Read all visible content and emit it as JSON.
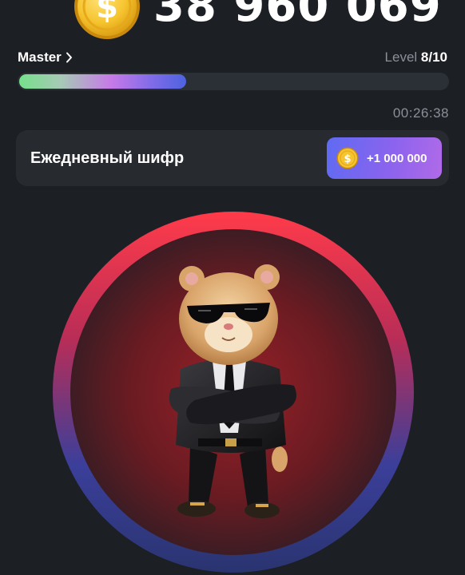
{
  "balance": {
    "value": "38 960 069",
    "coin_icon": "dollar-coin-icon"
  },
  "level": {
    "rank_label": "Master",
    "level_prefix": "Level",
    "level_value": "8/10",
    "progress": 0.39
  },
  "timer": {
    "value": "00:26:38"
  },
  "daily_cipher": {
    "title": "Ежедневный шифр",
    "reward": "+1 000 000",
    "coin_icon": "dollar-coin-icon"
  },
  "tap_character": {
    "name_icon": "hamster-in-suit-icon"
  },
  "colors": {
    "background": "#1c1f24",
    "card": "#272a2f",
    "accent_purple": "#8b63ee",
    "coin_gold": "#f6c42f",
    "ring_red": "#ff3b4a",
    "ring_blue": "#3b3f9a"
  }
}
